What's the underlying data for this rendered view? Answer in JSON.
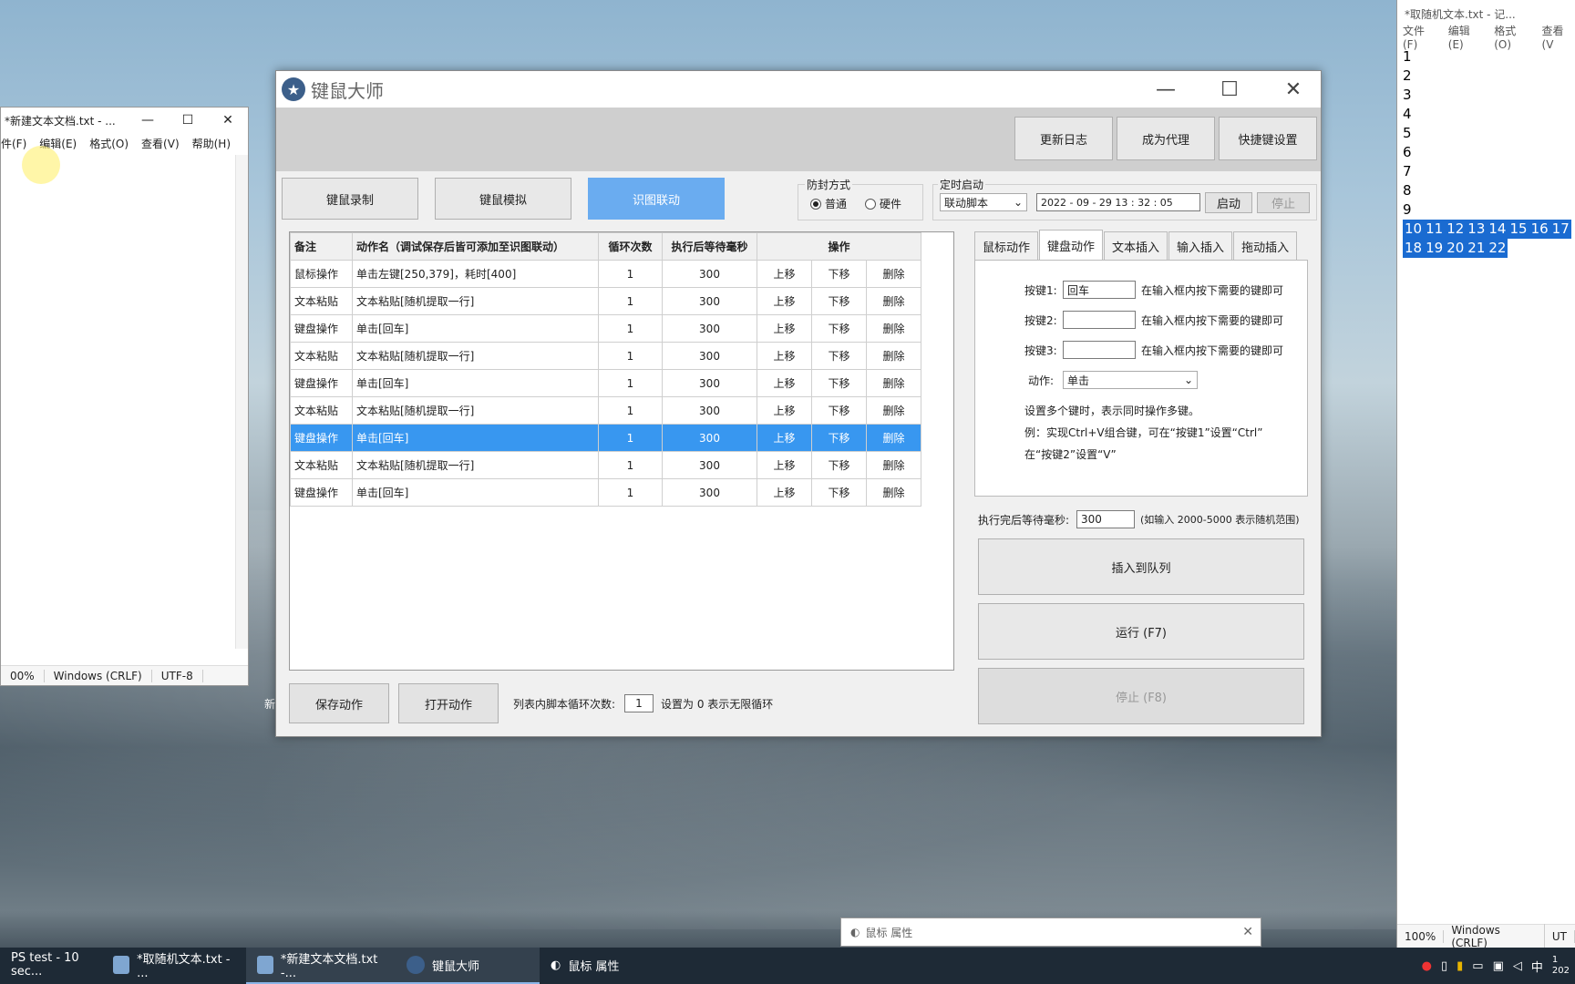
{
  "left_notepad": {
    "title": "*新建文本文档.txt - ...",
    "menu": [
      "件(F)",
      "编辑(E)",
      "格式(O)",
      "查看(V)",
      "帮助(H)"
    ],
    "status": [
      "00%",
      "Windows (CRLF)",
      "UTF-8"
    ],
    "desktop_text": "新"
  },
  "right_notepad": {
    "title": "*取随机文本.txt - 记...",
    "menu": [
      "文件(F)",
      "编辑(E)",
      "格式(O)",
      "查看(V"
    ],
    "lines": [
      "1",
      "2",
      "3",
      "4",
      "5",
      "6",
      "7",
      "8",
      "9",
      "10",
      "11",
      "12",
      "13",
      "14",
      "15",
      "16",
      "17",
      "18",
      "19",
      "20",
      "21",
      "22"
    ],
    "status": [
      "100%",
      "Windows (CRLF)",
      "UT"
    ]
  },
  "app": {
    "title": "键鼠大师",
    "top_buttons": [
      "更新日志",
      "成为代理",
      "快捷键设置"
    ],
    "mode_buttons": [
      "键鼠录制",
      "键鼠模拟",
      "识图联动"
    ],
    "anti_block": {
      "label": "防封方式",
      "options": [
        "普通",
        "硬件"
      ],
      "selected": "普通"
    },
    "timer": {
      "label": "定时启动",
      "script": "联动脚本",
      "datetime": "2022 - 09 - 29    13 : 32 : 05",
      "start": "启动",
      "stop": "停止"
    },
    "table": {
      "headers": [
        "备注",
        "动作名（调试保存后皆可添加至识图联动）",
        "循环次数",
        "执行后等待毫秒",
        "操作"
      ],
      "rows": [
        {
          "note": "鼠标操作",
          "name": "单击左键[250,379]，耗时[400]",
          "loops": "1",
          "wait": "300"
        },
        {
          "note": "文本粘贴",
          "name": "文本粘贴[随机提取一行]",
          "loops": "1",
          "wait": "300"
        },
        {
          "note": "键盘操作",
          "name": "单击[回车]",
          "loops": "1",
          "wait": "300"
        },
        {
          "note": "文本粘贴",
          "name": "文本粘贴[随机提取一行]",
          "loops": "1",
          "wait": "300"
        },
        {
          "note": "键盘操作",
          "name": "单击[回车]",
          "loops": "1",
          "wait": "300"
        },
        {
          "note": "文本粘贴",
          "name": "文本粘贴[随机提取一行]",
          "loops": "1",
          "wait": "300"
        },
        {
          "note": "键盘操作",
          "name": "单击[回车]",
          "loops": "1",
          "wait": "300",
          "selected": true
        },
        {
          "note": "文本粘贴",
          "name": "文本粘贴[随机提取一行]",
          "loops": "1",
          "wait": "300"
        },
        {
          "note": "键盘操作",
          "name": "单击[回车]",
          "loops": "1",
          "wait": "300"
        }
      ],
      "op_labels": [
        "上移",
        "下移",
        "删除"
      ]
    },
    "bottom": {
      "save": "保存动作",
      "open": "打开动作",
      "loop_label": "列表内脚本循环次数:",
      "loop_value": "1",
      "loop_hint": "设置为 0 表示无限循环"
    },
    "tabs": [
      "鼠标动作",
      "键盘动作",
      "文本插入",
      "输入插入",
      "拖动插入"
    ],
    "active_tab": "键盘动作",
    "key_panel": {
      "key1_label": "按键1:",
      "key1_value": "回车",
      "key2_label": "按键2:",
      "key2_value": "",
      "key3_label": "按键3:",
      "key3_value": "",
      "key_hint": "在输入框内按下需要的键即可",
      "action_label": "动作:",
      "action_value": "单击",
      "note1": "设置多个键时，表示同时操作多键。",
      "note2": "例：实现Ctrl+V组合键，可在“按键1”设置“Ctrl”",
      "note3": "在“按键2”设置“V”"
    },
    "wait_label": "执行完后等待毫秒:",
    "wait_value": "300",
    "wait_hint": "(如输入 2000-5000 表示随机范围)",
    "insert_button": "插入到队列",
    "run_button": "运行 (F7)",
    "stop_button": "停止 (F8)"
  },
  "popup": {
    "title": "鼠标 属性"
  },
  "taskbar": {
    "items": [
      "PS test - 10 sec...",
      "*取随机文本.txt - ...",
      "*新建文本文档.txt -...",
      "键鼠大师",
      "鼠标 属性"
    ],
    "tray_lang": "中",
    "tray_time": "1",
    "tray_date": "202"
  }
}
